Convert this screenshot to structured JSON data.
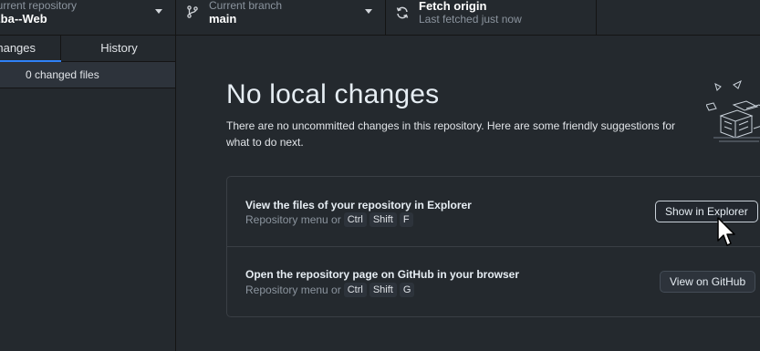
{
  "toolbar": {
    "repo": {
      "label": "Current repository",
      "name": "Eba--Web"
    },
    "branch": {
      "label": "Current branch",
      "name": "main"
    },
    "fetch": {
      "title": "Fetch origin",
      "subtitle": "Last fetched just now"
    }
  },
  "sidebar": {
    "tabs": [
      {
        "label": "Changes",
        "active": true
      },
      {
        "label": "History",
        "active": false
      }
    ],
    "changed_files": "0 changed files"
  },
  "main": {
    "title": "No local changes",
    "description": "There are no uncommitted changes in this repository. Here are some friendly suggestions for what to do next.",
    "cards": [
      {
        "title": "View the files of your repository in Explorer",
        "hint_prefix": "Repository menu or",
        "keys": [
          "Ctrl",
          "Shift",
          "F"
        ],
        "button": "Show in Explorer"
      },
      {
        "title": "Open the repository page on GitHub in your browser",
        "hint_prefix": "Repository menu or",
        "keys": [
          "Ctrl",
          "Shift",
          "G"
        ],
        "button": "View on GitHub"
      }
    ]
  },
  "colors": {
    "accent": "#2f81f7",
    "background": "#24292e"
  },
  "icons": [
    "git-branch-icon",
    "sync-icon",
    "chevron-down-icon",
    "illustration-boxes-icon",
    "mouse-cursor-icon"
  ]
}
